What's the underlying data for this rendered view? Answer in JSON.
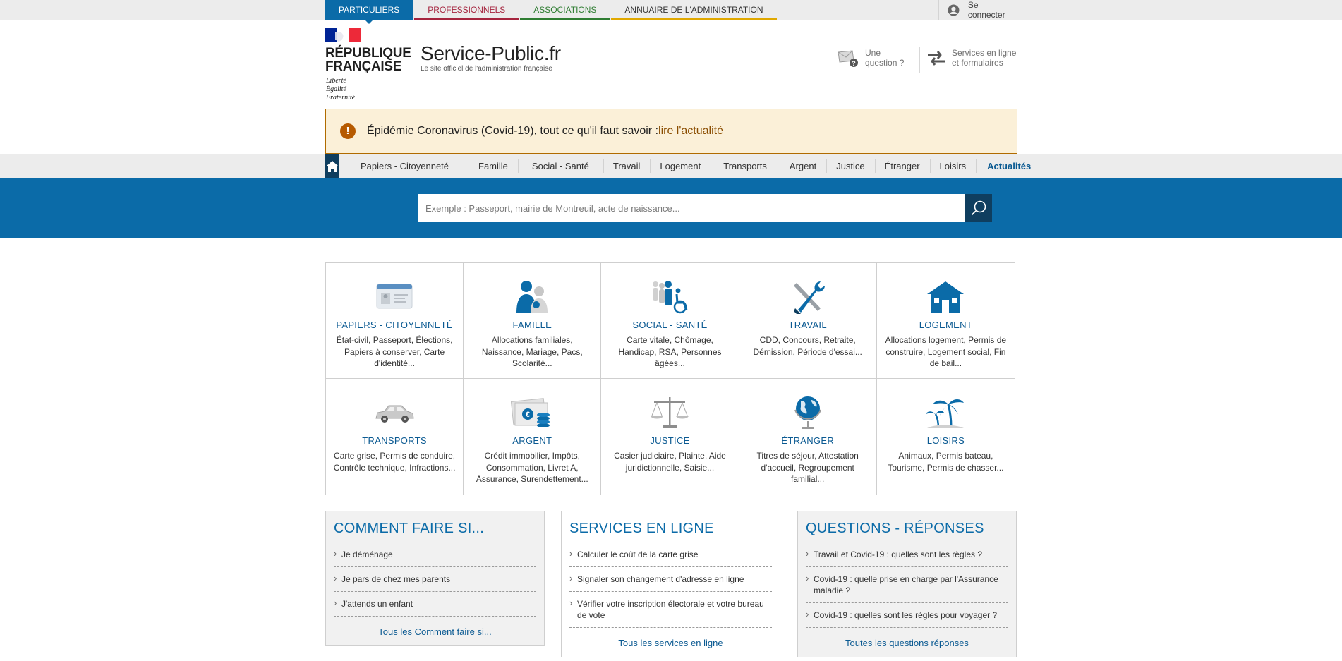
{
  "audience_tabs": [
    {
      "label": "PARTICULIERS",
      "color": "#0b6ba8"
    },
    {
      "label": "PROFESSIONNELS",
      "color": "#a5243e"
    },
    {
      "label": "ASSOCIATIONS",
      "color": "#2f7d32"
    },
    {
      "label": "ANNUAIRE DE L'ADMINISTRATION",
      "color": "#e0a800"
    }
  ],
  "login": {
    "label": "Se connecter"
  },
  "header": {
    "rf_line1": "RÉPUBLIQUE",
    "rf_line2": "FRANÇAISE",
    "motto1": "Liberté",
    "motto2": "Égalité",
    "motto3": "Fraternité",
    "site_title": "Service-Public.fr",
    "site_subtitle": "Le site officiel de l'administration française",
    "question_line1": "Une",
    "question_line2": "question ?",
    "services_line1": "Services en ligne",
    "services_line2": "et formulaires"
  },
  "alert": {
    "text": "Épidémie Coronavirus (Covid-19), tout ce qu'il faut savoir : ",
    "link": "lire l'actualité"
  },
  "nav": {
    "items": [
      "Papiers - Citoyenneté",
      "Famille",
      "Social - Santé",
      "Travail",
      "Logement",
      "Transports",
      "Argent",
      "Justice",
      "Étranger",
      "Loisirs",
      "Actualités"
    ]
  },
  "search": {
    "placeholder": "Exemple : Passeport, mairie de Montreuil, acte de naissance..."
  },
  "themes": [
    {
      "title": "PAPIERS - CITOYENNETÉ",
      "desc": "État-civil, Passeport, Élections, Papiers à conserver, Carte d'identité...",
      "icon": "id-card-icon"
    },
    {
      "title": "FAMILLE",
      "desc": "Allocations familiales, Naissance, Mariage, Pacs, Scolarité...",
      "icon": "family-icon"
    },
    {
      "title": "SOCIAL - SANTÉ",
      "desc": "Carte vitale, Chômage, Handicap, RSA, Personnes âgées...",
      "icon": "wheelchair-icon"
    },
    {
      "title": "TRAVAIL",
      "desc": "CDD, Concours, Retraite, Démission, Période d'essai...",
      "icon": "tools-icon"
    },
    {
      "title": "LOGEMENT",
      "desc": "Allocations logement, Permis de construire, Logement social, Fin de bail...",
      "icon": "house-icon"
    },
    {
      "title": "TRANSPORTS",
      "desc": "Carte grise, Permis de conduire, Contrôle technique, Infractions...",
      "icon": "car-icon"
    },
    {
      "title": "ARGENT",
      "desc": "Crédit immobilier, Impôts, Consommation, Livret A, Assurance, Surendettement...",
      "icon": "money-icon"
    },
    {
      "title": "JUSTICE",
      "desc": "Casier judiciaire, Plainte, Aide juridictionnelle, Saisie...",
      "icon": "scales-icon"
    },
    {
      "title": "ÉTRANGER",
      "desc": "Titres de séjour, Attestation d'accueil, Regroupement familial...",
      "icon": "globe-icon"
    },
    {
      "title": "LOISIRS",
      "desc": "Animaux, Permis bateau, Tourisme, Permis de chasser...",
      "icon": "palm-tree-icon"
    }
  ],
  "blocks": {
    "comment": {
      "title": "COMMENT FAIRE SI...",
      "items": [
        "Je déménage",
        "Je pars de chez mes parents",
        "J'attends un enfant"
      ],
      "more": "Tous les Comment faire si..."
    },
    "services": {
      "title": "SERVICES EN LIGNE",
      "items": [
        "Calculer le coût de la carte grise",
        "Signaler son changement d'adresse en ligne",
        "Vérifier votre inscription électorale et votre bureau de vote"
      ],
      "more": "Tous les services en ligne"
    },
    "questions": {
      "title": "QUESTIONS - RÉPONSES",
      "items": [
        "Travail et Covid-19 : quelles sont les règles ?",
        "Covid-19 : quelle prise en charge par l'Assurance maladie ?",
        "Covid-19 : quelles sont les règles pour voyager ?"
      ],
      "more": "Toutes les questions réponses"
    }
  },
  "colors": {
    "brand_blue": "#0b6ba8",
    "dark_navy": "#0f3e5f",
    "alert_bg": "#fbf0d8",
    "alert_border": "#b06b00"
  }
}
